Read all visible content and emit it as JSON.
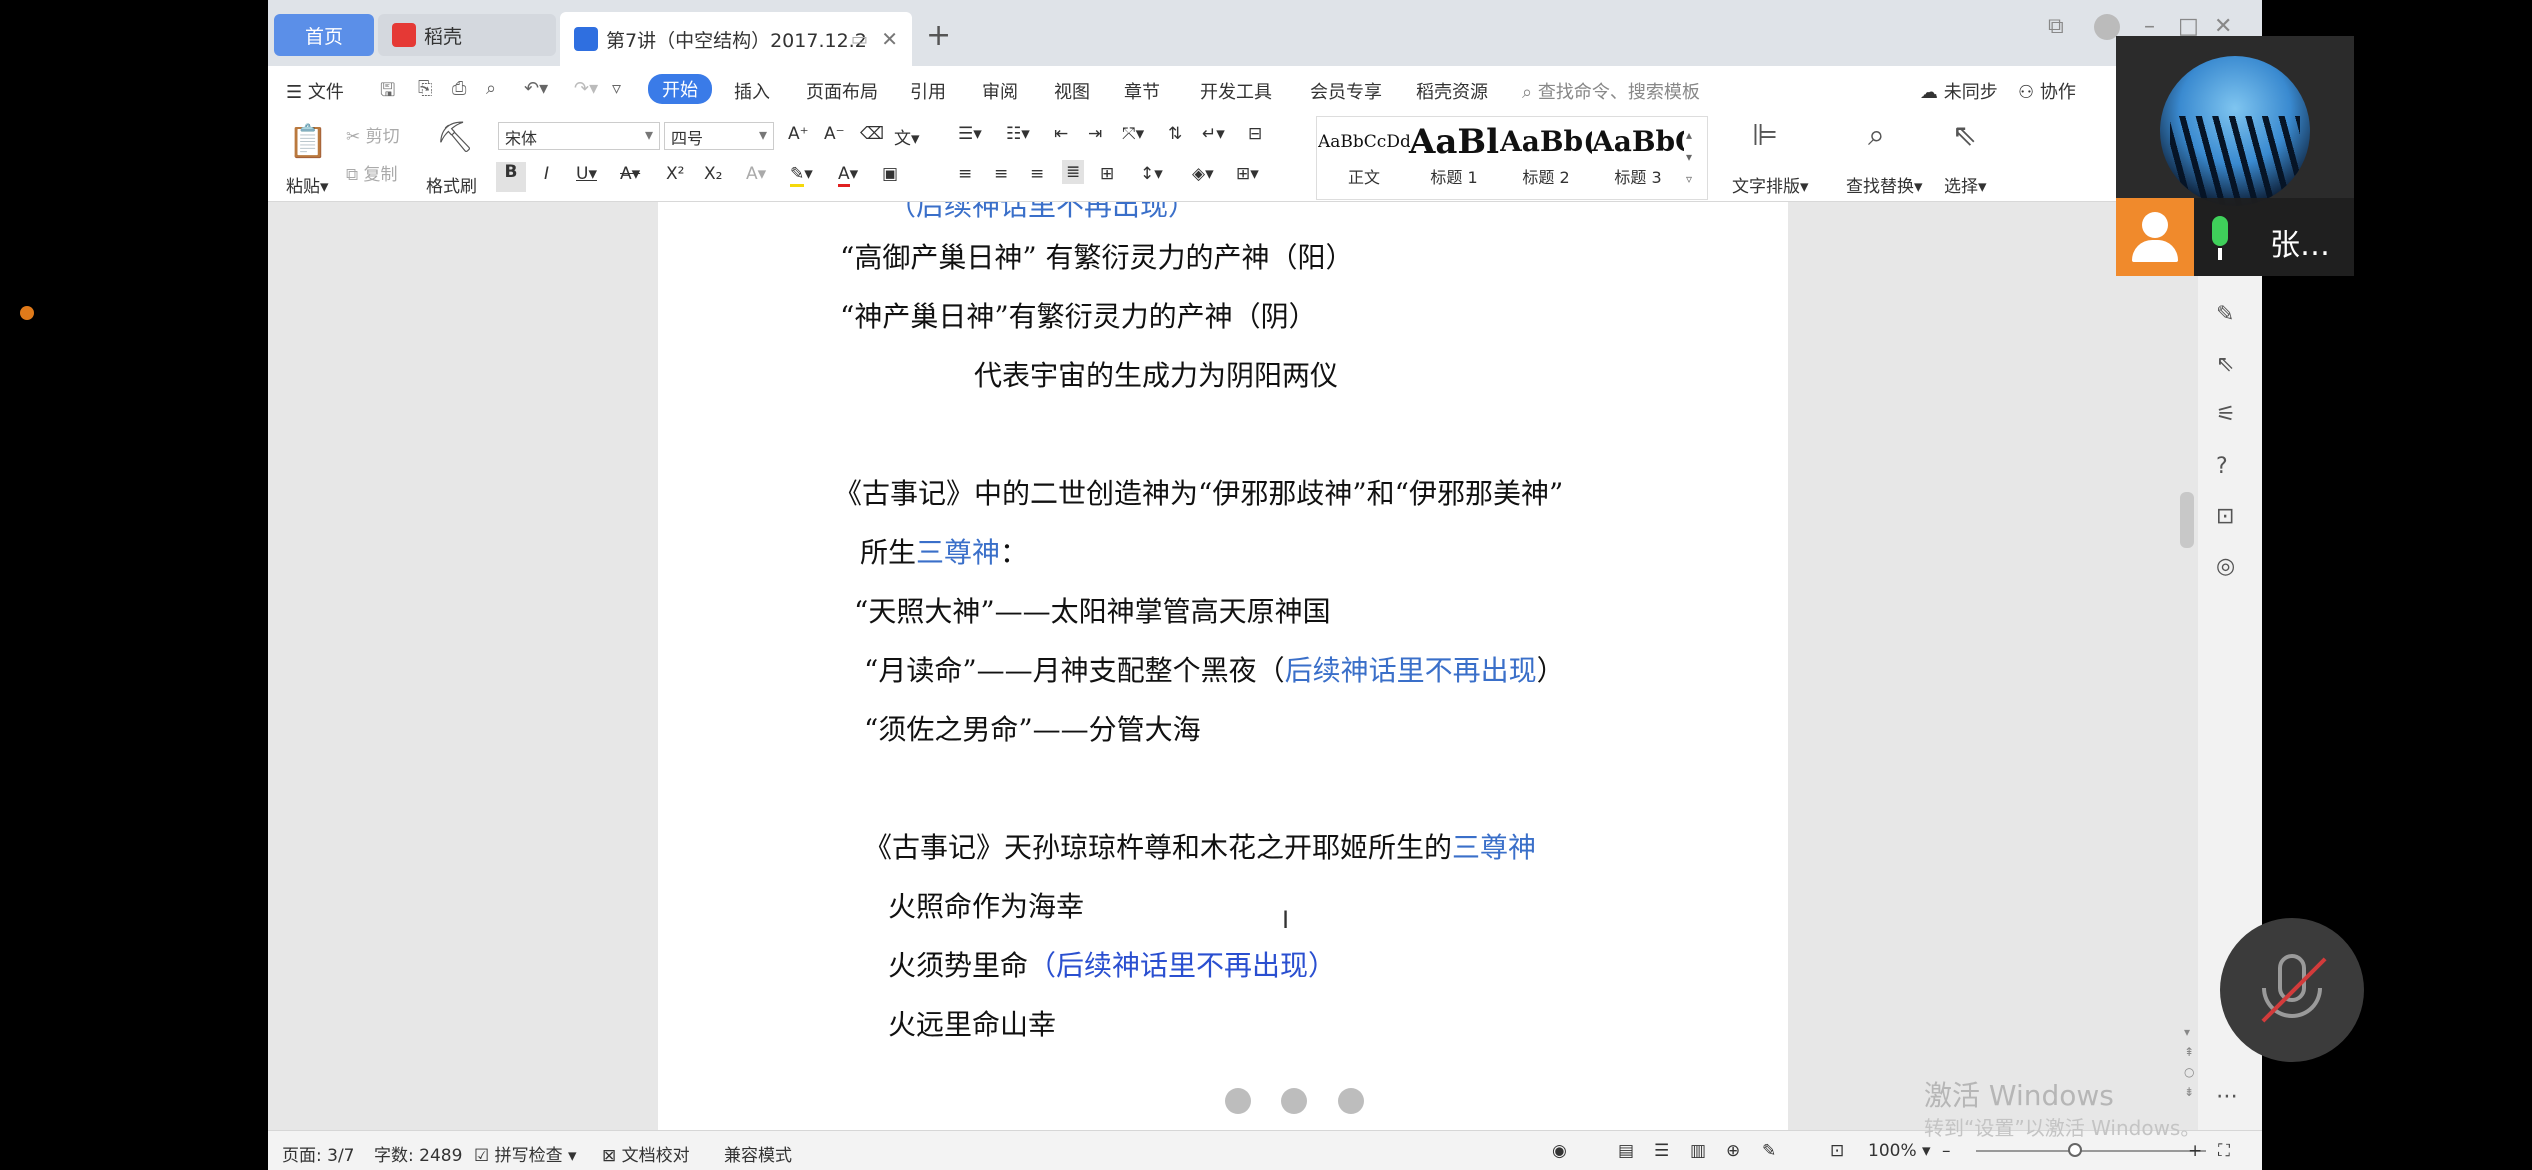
{
  "tabs": {
    "home": "首页",
    "daoke": "稻壳",
    "document": "第7讲（中空结构）2017.12.2"
  },
  "menu": {
    "file": "文件",
    "start": "开始",
    "insert": "插入",
    "layout": "页面布局",
    "reference": "引用",
    "review": "审阅",
    "view": "视图",
    "chapter": "章节",
    "devtools": "开发工具",
    "member": "会员专享",
    "daoke_res": "稻壳资源",
    "search_placeholder": "查找命令、搜索模板",
    "sync": "未同步",
    "collab": "协作"
  },
  "ribbon": {
    "paste": "粘贴",
    "cut": "剪切",
    "copy": "复制",
    "format_painter": "格式刷",
    "font_name": "宋体",
    "font_size": "四号",
    "styles": [
      {
        "preview": "AaBbCcDd",
        "caption": "正文"
      },
      {
        "preview": "AaBl",
        "caption": "标题 1"
      },
      {
        "preview": "AaBb(",
        "caption": "标题 2"
      },
      {
        "preview": "AaBbC",
        "caption": "标题 3"
      }
    ],
    "text_layout": "文字排版",
    "find_replace": "查找替换",
    "select": "选择"
  },
  "document": {
    "line_top_partial": "（后续神话里不再出现）",
    "line1": "“高御产巢日神”  有繁衍灵力的产神（阳）",
    "line2": "“神产巢日神”有繁衍灵力的产神（阴）",
    "line3": "代表宇宙的生成力为阴阳两仪",
    "line4": "《古事记》中的二世创造神为“伊邪那歧神”和“伊邪那美神”",
    "line5_pre": "所生",
    "line5_blue": "三尊神",
    "line5_post": "：",
    "line6": "“天照大神”——太阳神掌管高天原神国",
    "line7_pre": "“月读命”——月神支配整个黑夜（",
    "line7_blue": "后续神话里不再出现",
    "line7_post": "）",
    "line8": "“须佐之男命”——分管大海",
    "line9_pre": "《古事记》天孙琼琼杵尊和木花之开耶姬所生的",
    "line9_blue": "三尊神",
    "line10": "火照命作为海幸",
    "line11_pre": "火须势里命",
    "line11_blue": "（后续神话里不再出现）",
    "line12": "火远里命山幸"
  },
  "status": {
    "page": "页面: 3/7",
    "words": "字数: 2489",
    "spellcheck": "拼写检查",
    "proof": "文档校对",
    "compat": "兼容模式",
    "zoom": "100%"
  },
  "overlay": {
    "participant_name": "张…",
    "watermark_title": "激活 Windows",
    "watermark_sub": "转到“设置”以激活 Windows。"
  }
}
